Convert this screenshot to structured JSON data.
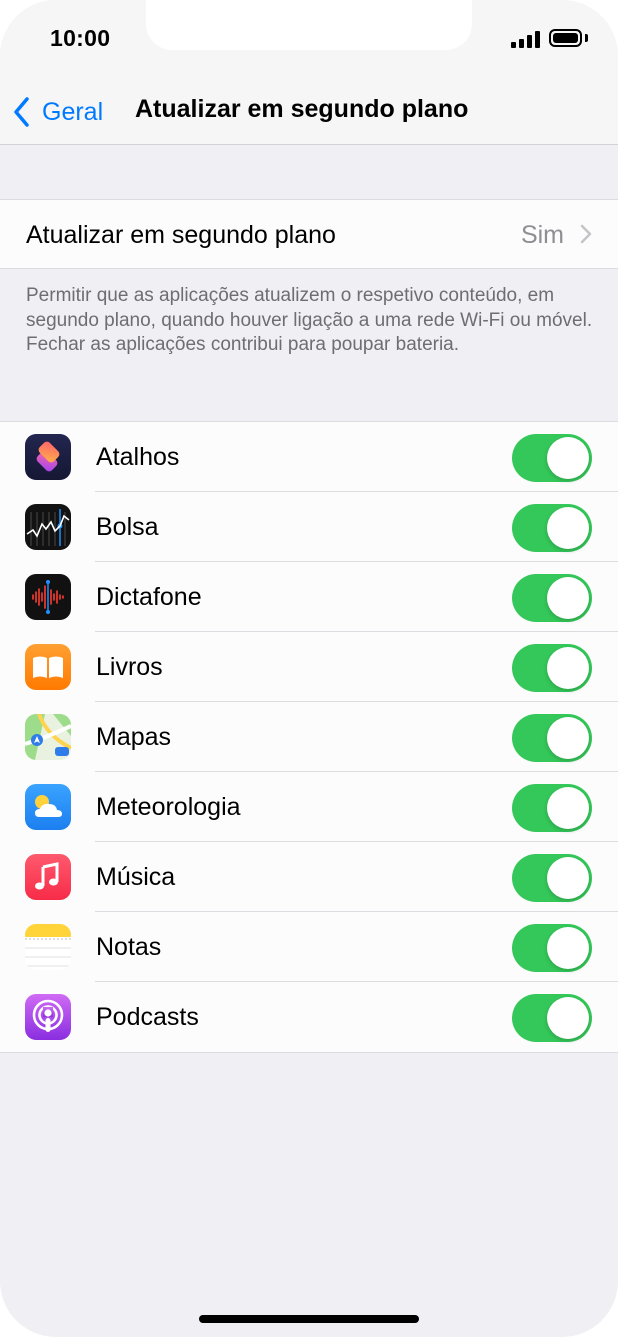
{
  "status_bar": {
    "time": "10:00"
  },
  "nav": {
    "back_label": "Geral",
    "title": "Atualizar em segundo plano"
  },
  "background_refresh": {
    "label": "Atualizar em segundo plano",
    "value": "Sim",
    "footer": "Permitir que as aplicações atualizem o respetivo conteúdo, em segundo plano, quando houver ligação a uma rede Wi-Fi ou móvel. Fechar as aplicações contribui para poupar bateria."
  },
  "apps": [
    {
      "label": "Atalhos",
      "icon": "shortcuts-icon",
      "enabled": true
    },
    {
      "label": "Bolsa",
      "icon": "stocks-icon",
      "enabled": true
    },
    {
      "label": "Dictafone",
      "icon": "voice-memos-icon",
      "enabled": true
    },
    {
      "label": "Livros",
      "icon": "books-icon",
      "enabled": true
    },
    {
      "label": "Mapas",
      "icon": "maps-icon",
      "enabled": true
    },
    {
      "label": "Meteorologia",
      "icon": "weather-icon",
      "enabled": true
    },
    {
      "label": "Música",
      "icon": "music-icon",
      "enabled": true
    },
    {
      "label": "Notas",
      "icon": "notes-icon",
      "enabled": true
    },
    {
      "label": "Podcasts",
      "icon": "podcasts-icon",
      "enabled": true
    }
  ],
  "colors": {
    "accent": "#007aff",
    "toggle_on": "#34c759"
  }
}
